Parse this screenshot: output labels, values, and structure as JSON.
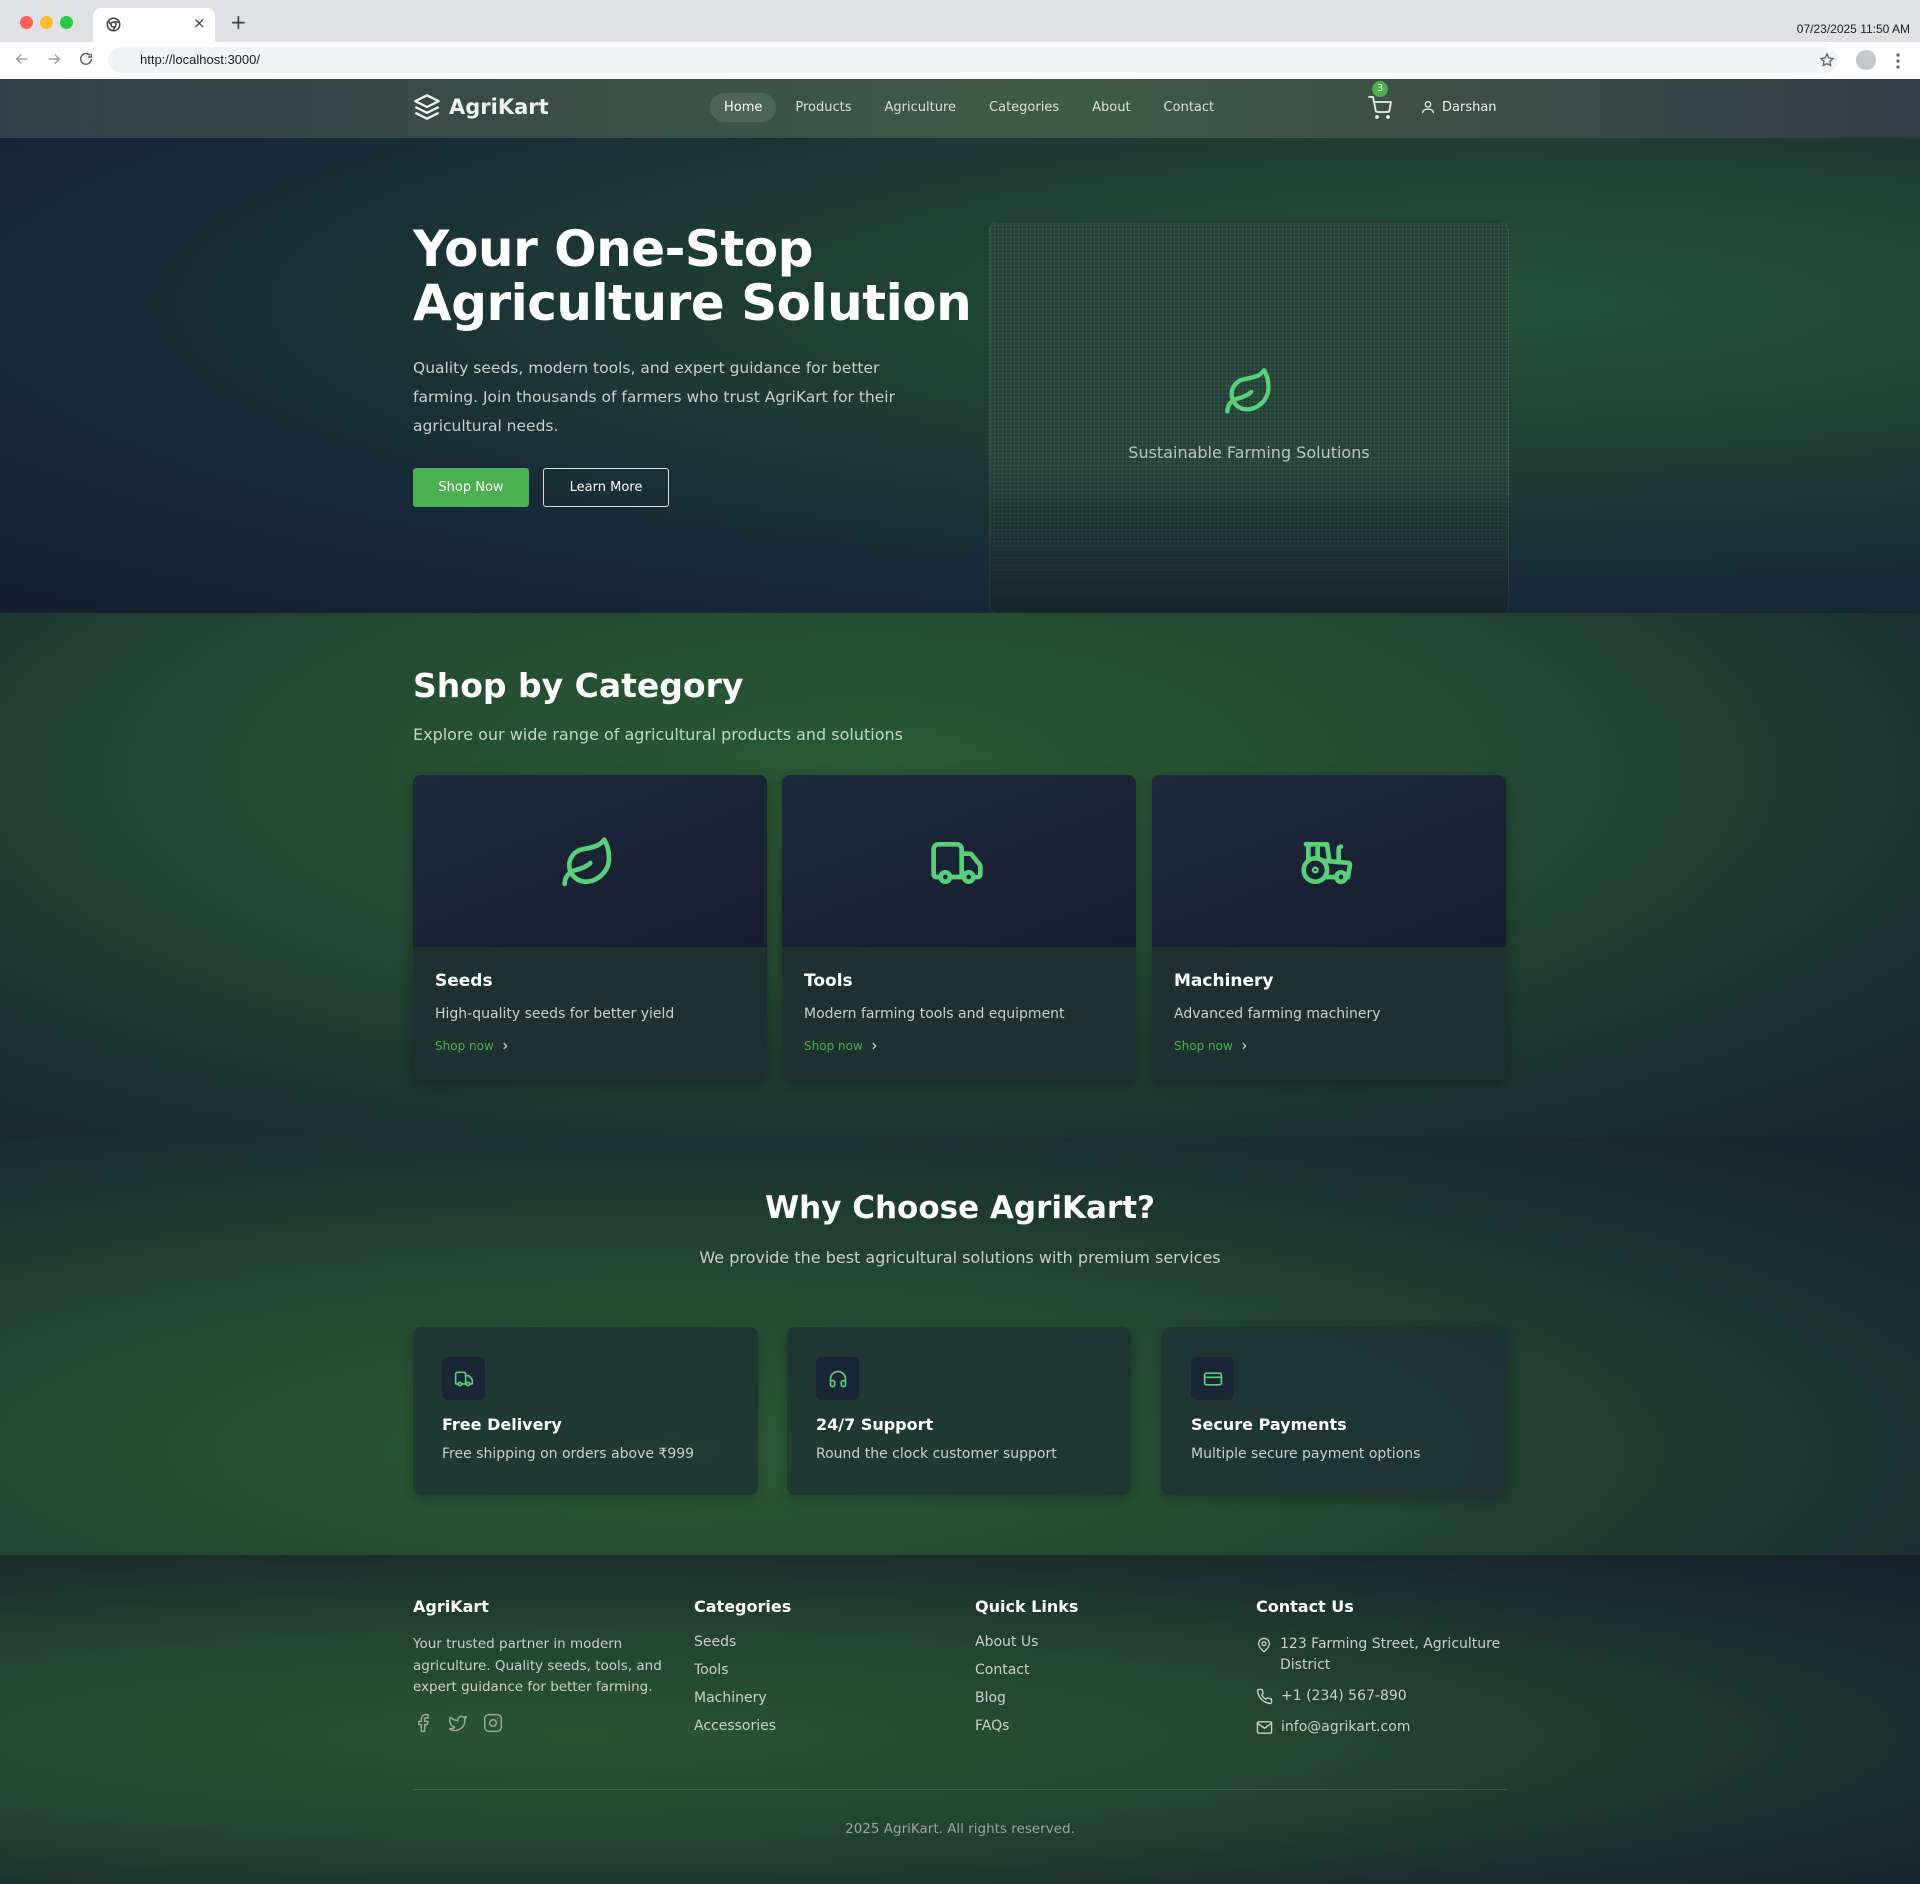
{
  "browser": {
    "url": "http://localhost:3000/",
    "datetime": "07/23/2025 11:50 AM",
    "tab_close": "×",
    "new_tab": "+"
  },
  "nav": {
    "brand": "AgriKart",
    "menu": [
      "Home",
      "Products",
      "Agriculture",
      "Categories",
      "About",
      "Contact"
    ],
    "active_item": "Home",
    "cart_count": "3",
    "user_name": "Darshan"
  },
  "hero": {
    "title": "Your One-Stop Agriculture Solution",
    "subtitle": "Quality seeds, modern tools, and expert guidance for better farming. Join thousands of farmers who trust AgriKart for their agricultural needs.",
    "primary_button": "Shop Now",
    "secondary_button": "Learn More",
    "card_caption": "Sustainable Farming Solutions",
    "card_icon": "leaf-icon"
  },
  "categories": {
    "title": "Shop by Category",
    "subtitle": "Explore our wide range of agricultural products and solutions",
    "link_label": "Shop now",
    "items": [
      {
        "name": "Seeds",
        "description": "High-quality seeds for better yield",
        "icon": "leaf-icon"
      },
      {
        "name": "Tools",
        "description": "Modern farming tools and equipment",
        "icon": "truck-icon"
      },
      {
        "name": "Machinery",
        "description": "Advanced farming machinery",
        "icon": "tractor-icon"
      }
    ]
  },
  "why": {
    "title": "Why Choose AgriKart?",
    "subtitle": "We provide the best agricultural solutions with premium services",
    "features": [
      {
        "title": "Free Delivery",
        "description": "Free shipping on orders above ₹999",
        "icon": "truck-icon"
      },
      {
        "title": "24/7 Support",
        "description": "Round the clock customer support",
        "icon": "headphones-icon"
      },
      {
        "title": "Secure Payments",
        "description": "Multiple secure payment options",
        "icon": "credit-card-icon"
      }
    ]
  },
  "footer": {
    "about": {
      "title": "AgriKart",
      "text": "Your trusted partner in modern agriculture. Quality seeds, tools, and expert guidance for better farming.",
      "social": [
        "facebook-icon",
        "twitter-icon",
        "instagram-icon"
      ]
    },
    "categories": {
      "title": "Categories",
      "links": [
        "Seeds",
        "Tools",
        "Machinery",
        "Accessories"
      ]
    },
    "quick_links": {
      "title": "Quick Links",
      "links": [
        "About Us",
        "Contact",
        "Blog",
        "FAQs"
      ]
    },
    "contact": {
      "title": "Contact Us",
      "address": "123 Farming Street, Agriculture District",
      "phone": "+1 (234) 567-890",
      "email": "info@agrikart.com"
    },
    "copyright": "2025 AgriKart. All rights reserved."
  },
  "colors": {
    "accent": "#4caf50",
    "icon_green": "#5bd07a",
    "nav_active": "#4d6656"
  }
}
